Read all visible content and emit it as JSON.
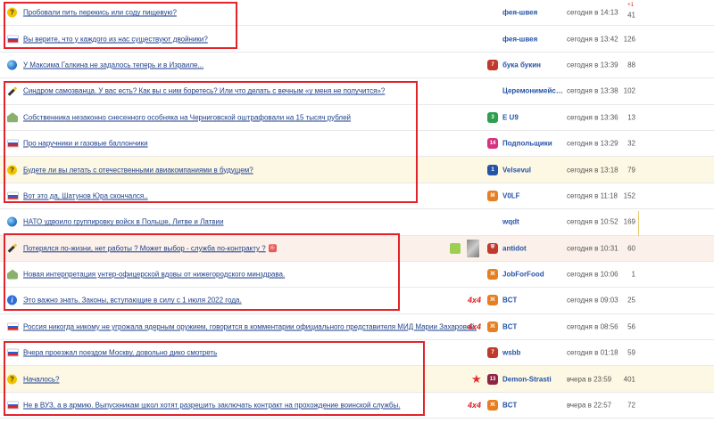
{
  "rows": [
    {
      "icon": "smile",
      "title": "Пробовали пить перекись или соду пищевую?",
      "badge": "",
      "badge_color": "",
      "user": "фея-швея",
      "time": "сегодня в 14:13",
      "count": "41",
      "plus": "+1",
      "hl": ""
    },
    {
      "icon": "flag",
      "title": "Вы верите, что у каждого из нас существуют двойники?",
      "badge": "",
      "badge_color": "",
      "user": "фея-швея",
      "time": "сегодня в 13:42",
      "count": "126",
      "plus": "",
      "hl": ""
    },
    {
      "icon": "globe",
      "title": "У Максима Галкина не задалось теперь и в Израиле...",
      "badge": "7",
      "badge_color": "#c0392b",
      "user": "бука букин",
      "time": "сегодня в 13:39",
      "count": "88",
      "plus": "",
      "hl": ""
    },
    {
      "icon": "pen",
      "title": "Синдром самозванца. У вас есть? Как вы с ним боретесь? Или что делать с вечным «у меня не получится»?",
      "badge": "",
      "badge_color": "",
      "user": "Церемонимейстер",
      "time": "сегодня в 13:38",
      "count": "102",
      "plus": "",
      "hl": ""
    },
    {
      "icon": "house",
      "title": "Собственника незаконно снесенного особняка на Черниговской оштрафовали на 15 тысяч рублей",
      "badge": "3",
      "badge_color": "#2e9e4f",
      "user": "E U9",
      "time": "сегодня в 13:36",
      "count": "13",
      "plus": "",
      "hl": ""
    },
    {
      "icon": "flag",
      "title": "Про наручники и газовые баллончики",
      "badge": "14",
      "badge_color": "#d6337f",
      "user": "Подпольщики",
      "time": "сегодня в 13:29",
      "count": "32",
      "plus": "",
      "hl": ""
    },
    {
      "icon": "q",
      "title": "Будете ли вы летать с отечественными авиакомпаниями в будущем?",
      "badge": "1",
      "badge_color": "#2553a6",
      "user": "Velsevul",
      "time": "сегодня в 13:18",
      "count": "79",
      "plus": "",
      "hl": "hl"
    },
    {
      "icon": "flag",
      "title": "Вот это да, Шатунов Юра скончался..",
      "badge": "M",
      "badge_color": "#e67e22",
      "user": "V0LF",
      "time": "сегодня в 11:18",
      "count": "152",
      "plus": "",
      "hl": ""
    },
    {
      "icon": "globe",
      "title": "НАТО удвоило группировку войск в Польше, Литве и Латвии",
      "badge": "",
      "badge_color": "",
      "user": "wqdt",
      "time": "сегодня в 10:52",
      "count": "169",
      "plus": "",
      "hl": ""
    },
    {
      "icon": "pen",
      "title": "Потерялся по-жизни, нет работы ? Может выбор - служба по-контракту ?",
      "badge": "⛨",
      "badge_color": "#c0392b",
      "user": "antidot",
      "time": "сегодня в 10:31",
      "count": "60",
      "plus": "",
      "hl": "hl2",
      "extra": true,
      "images": true
    },
    {
      "icon": "house",
      "title": "Новая интерпретация унтер-офицерской вдовы от нижегородского минздрава.",
      "badge": "Ж",
      "badge_color": "#e67e22",
      "user": "JobForFood",
      "time": "сегодня в 10:06",
      "count": "1",
      "plus": "",
      "hl": ""
    },
    {
      "icon": "i",
      "title": "Это важно знать. Законы, вступающие в силу с 1 июля 2022 года.",
      "badge": "Ж",
      "badge_color": "#e67e22",
      "user": "BCT",
      "time": "сегодня в 09:03",
      "count": "25",
      "plus": "",
      "hl": "",
      "tag": "4x4"
    },
    {
      "icon": "flag",
      "title": "Россия никогда никому не угрожала ядерным оружием, говорится в комментарии официального представителя МИД Марии Захаровой.",
      "badge": "Ж",
      "badge_color": "#e67e22",
      "user": "BCT",
      "time": "сегодня в 08:56",
      "count": "56",
      "plus": "",
      "hl": "",
      "tag": "4x4"
    },
    {
      "icon": "flag",
      "title": "Вчера проезжал поездом Москву, довольно дико смотреть",
      "badge": "7",
      "badge_color": "#c0392b",
      "user": "wsbb",
      "time": "сегодня в 01:18",
      "count": "59",
      "plus": "",
      "hl": ""
    },
    {
      "icon": "q",
      "title": "Началось?",
      "badge": "13",
      "badge_color": "#8e2446",
      "user": "Demon-Strasti",
      "time": "вчера в 23:59",
      "count": "401",
      "plus": "",
      "hl": "hl",
      "star": true
    },
    {
      "icon": "flag",
      "title": "Не в ВУЗ, а в армию. Выпускникам школ хотят разрешить заключать контракт на прохождение воинской службы.",
      "badge": "Ж",
      "badge_color": "#e67e22",
      "user": "BCT",
      "time": "вчера в 22:57",
      "count": "72",
      "plus": "",
      "hl": "",
      "tag": "4x4"
    }
  ],
  "colors": {
    "accent": "#2553a6",
    "link": "#1c3e8a",
    "highlight": "#e3232c"
  }
}
